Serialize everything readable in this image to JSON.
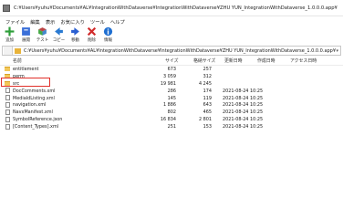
{
  "window": {
    "title": "C:¥Users¥yuhu¥Documents¥AL¥IntegrationWithDataverse¥IntegrationWithDataverse¥ZHU YUN_IntegrationWithDataverse_1.0.0.0.app¥"
  },
  "menu": [
    "ファイル",
    "編集",
    "表示",
    "お気に入り",
    "ツール",
    "ヘルプ"
  ],
  "toolbar": [
    {
      "label": "追加",
      "icon": "add-icon",
      "color": "#2e9e3a"
    },
    {
      "label": "展開",
      "icon": "extract-icon",
      "color": "#2a5fd1"
    },
    {
      "label": "テスト",
      "icon": "test-icon",
      "color": "#1f8a3a"
    },
    {
      "label": "コピー",
      "icon": "copy-icon",
      "color": "#2a7ad1"
    },
    {
      "label": "移動",
      "icon": "move-icon",
      "color": "#2a5fd1"
    },
    {
      "label": "削除",
      "icon": "delete-icon",
      "color": "#d12a2a"
    },
    {
      "label": "情報",
      "icon": "info-icon",
      "color": "#1f6fd1"
    }
  ],
  "path": {
    "text": "C:¥Users¥yuhu¥Documents¥AL¥IntegrationWithDataverse¥IntegrationWithDataverse¥ZHU YUN_IntegrationWithDataverse_1.0.0.0.app¥"
  },
  "columns": {
    "name": "名前",
    "size": "サイズ",
    "packed": "格納サイズ",
    "date": "更新日時",
    "created": "作成日時",
    "attr": "アクセス日時"
  },
  "files": [
    {
      "name": "entitlement",
      "type": "folder",
      "size": "673",
      "packed": "257",
      "date": ""
    },
    {
      "name": "perm",
      "type": "folder",
      "size": "3 059",
      "packed": "312",
      "date": ""
    },
    {
      "name": "src",
      "type": "folder",
      "size": "19 981",
      "packed": "4 245",
      "date": ""
    },
    {
      "name": "DocComments.xml",
      "type": "file",
      "size": "286",
      "packed": "174",
      "date": "2021-08-24 10:25"
    },
    {
      "name": "MediaIdListing.xml",
      "type": "file",
      "size": "145",
      "packed": "119",
      "date": "2021-08-24 10:25"
    },
    {
      "name": "navigation.xml",
      "type": "file",
      "size": "1 886",
      "packed": "643",
      "date": "2021-08-24 10:25"
    },
    {
      "name": "NavxManifest.xml",
      "type": "file",
      "size": "802",
      "packed": "465",
      "date": "2021-08-24 10:25"
    },
    {
      "name": "SymbolReference.json",
      "type": "file",
      "size": "16 834",
      "packed": "2 801",
      "date": "2021-08-24 10:25"
    },
    {
      "name": "[Content_Types].xml",
      "type": "file",
      "size": "251",
      "packed": "153",
      "date": "2021-08-24 10:25"
    }
  ],
  "highlight_color": "#e0302a"
}
